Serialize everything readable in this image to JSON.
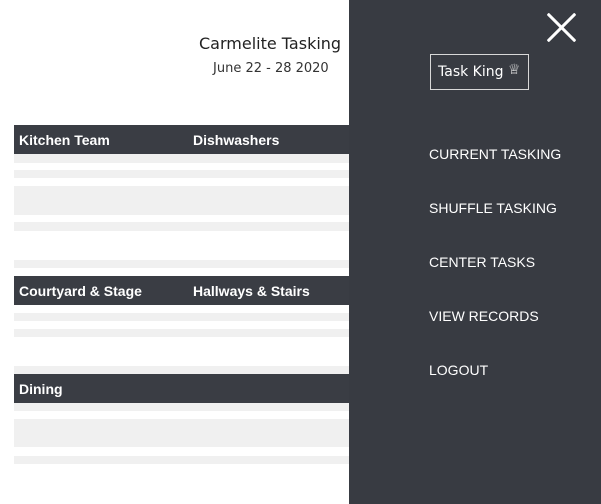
{
  "header": {
    "title": "Carmelite Tasking",
    "date_range": "June 22 - 28 2020"
  },
  "sections": [
    {
      "left_label": "Kitchen Team",
      "right_label": "Dishwashers"
    },
    {
      "left_label": "Courtyard & Stage",
      "right_label": "Hallways & Stairs"
    },
    {
      "left_label": "Dining",
      "right_label": ""
    }
  ],
  "drawer": {
    "close_icon": "close-icon",
    "brand": {
      "label": "Task King",
      "icon": "♕"
    },
    "nav": [
      "CURRENT TASKING",
      "SHUFFLE TASKING",
      "CENTER TASKS",
      "VIEW RECORDS",
      "LOGOUT"
    ]
  },
  "colors": {
    "drawer_bg": "#383b42",
    "section_bar": "#3a3d44",
    "row_stripe": "#f0f0f0"
  }
}
